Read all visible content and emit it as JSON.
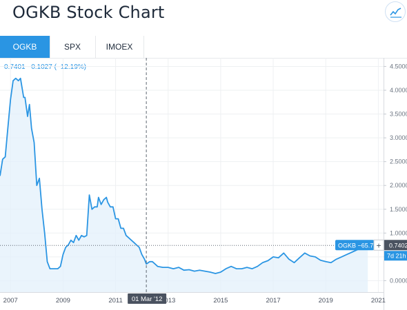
{
  "header": {
    "title": "OGKB Stock Chart",
    "chart_icon": "trend-chart-icon"
  },
  "tabs": [
    {
      "label": "OGKB",
      "active": true
    },
    {
      "label": "SPX",
      "active": false
    },
    {
      "label": "IMOEX",
      "active": false
    }
  ],
  "readout": "0.7401  −0.1027 (−12.19%)",
  "crosshair": {
    "date_label": "01 Mar '12",
    "price_label": "0.7402",
    "series_label": "OGKB −65.7",
    "plus": "+",
    "period_label": "7d 21h"
  },
  "colors": {
    "line": "#2a95e3",
    "fill": "#e3f0fb",
    "accent": "#2a95e3",
    "crosshair": "#5d6570"
  },
  "chart_data": {
    "type": "area",
    "title": "OGKB",
    "xlabel": "",
    "ylabel": "",
    "x_ticks": [
      "2007",
      "2009",
      "2011",
      "2013",
      "2015",
      "2017",
      "2019",
      "2021"
    ],
    "y_ticks": [
      "0.0000",
      "0.5000",
      "1.0000",
      "1.5000",
      "2.0000",
      "2.5000",
      "3.0000",
      "3.5000",
      "4.0000",
      "4.5000"
    ],
    "xlim": [
      2006.6,
      2021.2
    ],
    "ylim": [
      -0.24,
      4.68
    ],
    "grid": true,
    "series": [
      {
        "name": "OGKB",
        "x": [
          2006.6,
          2006.7,
          2006.8,
          2006.88,
          2007.0,
          2007.1,
          2007.2,
          2007.3,
          2007.38,
          2007.5,
          2007.55,
          2007.65,
          2007.72,
          2007.8,
          2007.9,
          2008.0,
          2008.1,
          2008.2,
          2008.3,
          2008.4,
          2008.5,
          2008.6,
          2008.7,
          2008.8,
          2008.9,
          2009.0,
          2009.1,
          2009.2,
          2009.3,
          2009.4,
          2009.5,
          2009.6,
          2009.7,
          2009.8,
          2009.9,
          2010.0,
          2010.1,
          2010.2,
          2010.3,
          2010.35,
          2010.45,
          2010.55,
          2010.65,
          2010.7,
          2010.8,
          2010.9,
          2011.0,
          2011.1,
          2011.2,
          2011.3,
          2011.4,
          2011.5,
          2011.6,
          2011.7,
          2011.8,
          2011.9,
          2012.0,
          2012.1,
          2012.17,
          2012.3,
          2012.4,
          2012.5,
          2012.6,
          2012.8,
          2013.0,
          2013.2,
          2013.4,
          2013.6,
          2013.8,
          2014.0,
          2014.2,
          2014.4,
          2014.6,
          2014.8,
          2015.0,
          2015.2,
          2015.4,
          2015.6,
          2015.8,
          2016.0,
          2016.2,
          2016.4,
          2016.6,
          2016.8,
          2017.0,
          2017.2,
          2017.4,
          2017.6,
          2017.8,
          2018.0,
          2018.2,
          2018.4,
          2018.6,
          2018.8,
          2019.0,
          2019.2,
          2019.4,
          2019.6,
          2019.8,
          2020.0,
          2020.2,
          2020.4,
          2020.6
        ],
        "y": [
          2.2,
          2.55,
          2.6,
          3.1,
          3.8,
          4.2,
          4.25,
          4.2,
          4.25,
          3.85,
          3.85,
          3.45,
          3.7,
          3.2,
          2.9,
          2.0,
          2.15,
          1.5,
          1.0,
          0.4,
          0.25,
          0.25,
          0.25,
          0.25,
          0.3,
          0.55,
          0.7,
          0.75,
          0.85,
          0.8,
          0.95,
          0.85,
          0.95,
          0.92,
          0.95,
          1.8,
          1.5,
          1.55,
          1.55,
          1.75,
          1.6,
          1.7,
          1.75,
          1.65,
          1.55,
          1.55,
          1.3,
          1.3,
          1.1,
          1.1,
          0.95,
          0.9,
          0.85,
          0.8,
          0.75,
          0.7,
          0.55,
          0.45,
          0.35,
          0.4,
          0.4,
          0.35,
          0.3,
          0.28,
          0.28,
          0.25,
          0.28,
          0.22,
          0.23,
          0.2,
          0.22,
          0.2,
          0.18,
          0.15,
          0.18,
          0.25,
          0.3,
          0.25,
          0.25,
          0.28,
          0.25,
          0.3,
          0.38,
          0.42,
          0.5,
          0.48,
          0.58,
          0.45,
          0.38,
          0.48,
          0.58,
          0.52,
          0.5,
          0.43,
          0.4,
          0.38,
          0.45,
          0.5,
          0.55,
          0.6,
          0.65,
          0.7,
          0.74
        ]
      }
    ]
  }
}
